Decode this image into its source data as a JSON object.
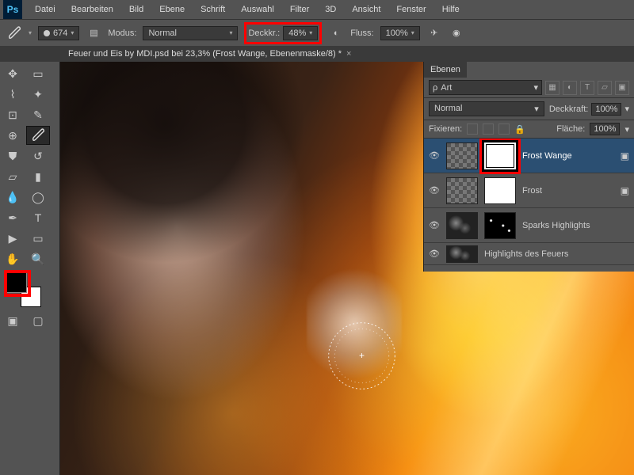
{
  "menu": {
    "items": [
      "Datei",
      "Bearbeiten",
      "Bild",
      "Ebene",
      "Schrift",
      "Auswahl",
      "Filter",
      "3D",
      "Ansicht",
      "Fenster",
      "Hilfe"
    ]
  },
  "options": {
    "brush_size": "674",
    "mode_label": "Modus:",
    "mode_value": "Normal",
    "opacity_label": "Deckkr.:",
    "opacity_value": "48%",
    "flow_label": "Fluss:",
    "flow_value": "100%"
  },
  "doc": {
    "title": "Feuer und Eis by MDI.psd bei 23,3% (Frost Wange, Ebenenmaske/8) *"
  },
  "layers_panel": {
    "title": "Ebenen",
    "filter": "Art",
    "blend": "Normal",
    "opacity_label": "Deckkraft:",
    "opacity_value": "100%",
    "lock_label": "Fixieren:",
    "fill_label": "Fläche:",
    "fill_value": "100%",
    "items": [
      {
        "name": "Frost Wange"
      },
      {
        "name": "Frost"
      },
      {
        "name": "Sparks Highlights"
      },
      {
        "name": "Highlights des Feuers"
      }
    ]
  }
}
